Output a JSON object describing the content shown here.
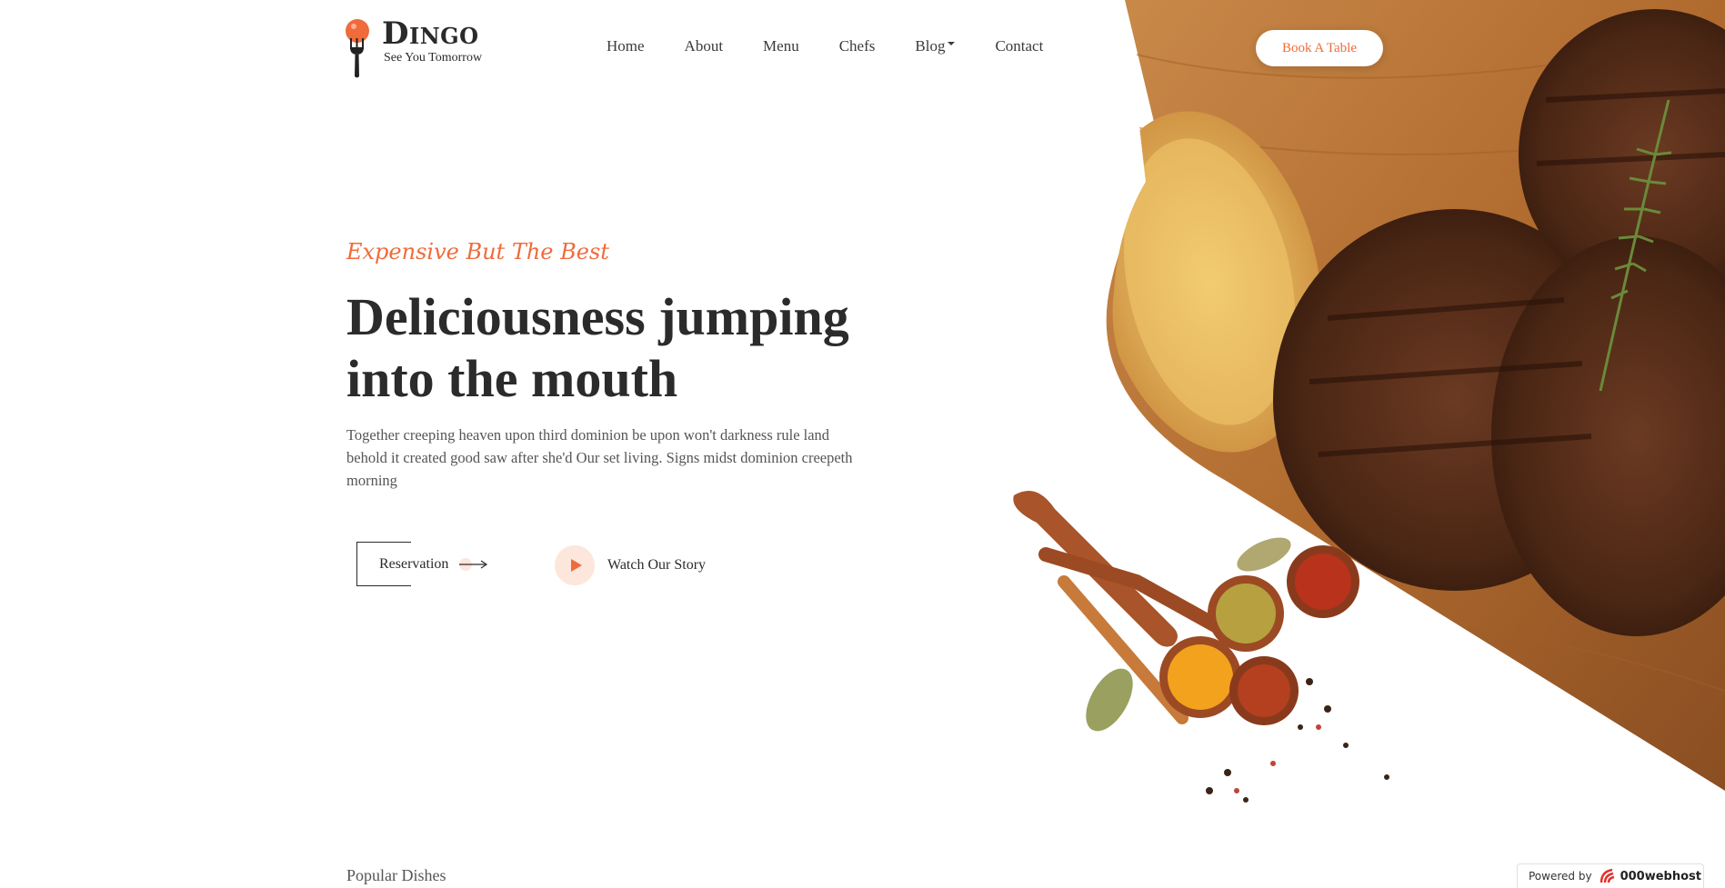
{
  "brand": {
    "name": "Dingo",
    "tagline": "See You Tomorrow",
    "accent_color": "#ef6b3b",
    "logo_icon": "fork-with-tomato-icon"
  },
  "nav": {
    "items": [
      {
        "label": "Home"
      },
      {
        "label": "About"
      },
      {
        "label": "Menu"
      },
      {
        "label": "Chefs"
      },
      {
        "label": "Blog",
        "has_dropdown": true
      },
      {
        "label": "Contact"
      }
    ],
    "cta_label": "Book A Table"
  },
  "hero": {
    "subtitle": "Expensive But The Best",
    "headline_line1": "Deliciousness jumping",
    "headline_line2": "into the mouth",
    "lead": "Together creeping heaven upon third dominion be upon won't darkness rule land behold it created good saw after she'd Our set living. Signs midst dominion creepeth morning",
    "reservation_label": "Reservation",
    "story_label": "Watch Our Story",
    "image": "grilled-steak-with-spices-image"
  },
  "section": {
    "popular_title": "Popular Dishes"
  },
  "footer_badge": {
    "powered_by": "Powered by",
    "host_name": "000webhost",
    "host_icon": "000webhost-logo-icon"
  }
}
